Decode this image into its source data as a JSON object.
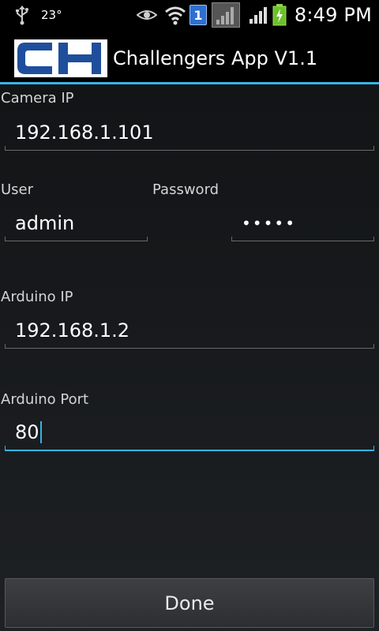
{
  "status_bar": {
    "temperature": "23°",
    "notification_badge": "1",
    "time": "8:49 PM"
  },
  "app": {
    "title": "Challengers App V1.1"
  },
  "form": {
    "camera_ip": {
      "label": "Camera IP",
      "value": "192.168.1.101"
    },
    "user": {
      "label": "User",
      "value": "admin"
    },
    "password": {
      "label": "Password",
      "value": "•••••"
    },
    "arduino_ip": {
      "label": "Arduino IP",
      "value": "192.168.1.2"
    },
    "arduino_port": {
      "label": "Arduino Port",
      "value": "80"
    }
  },
  "actions": {
    "done_label": "Done"
  },
  "colors": {
    "accent": "#33b5e5",
    "logo_blue": "#1f4f9c"
  }
}
